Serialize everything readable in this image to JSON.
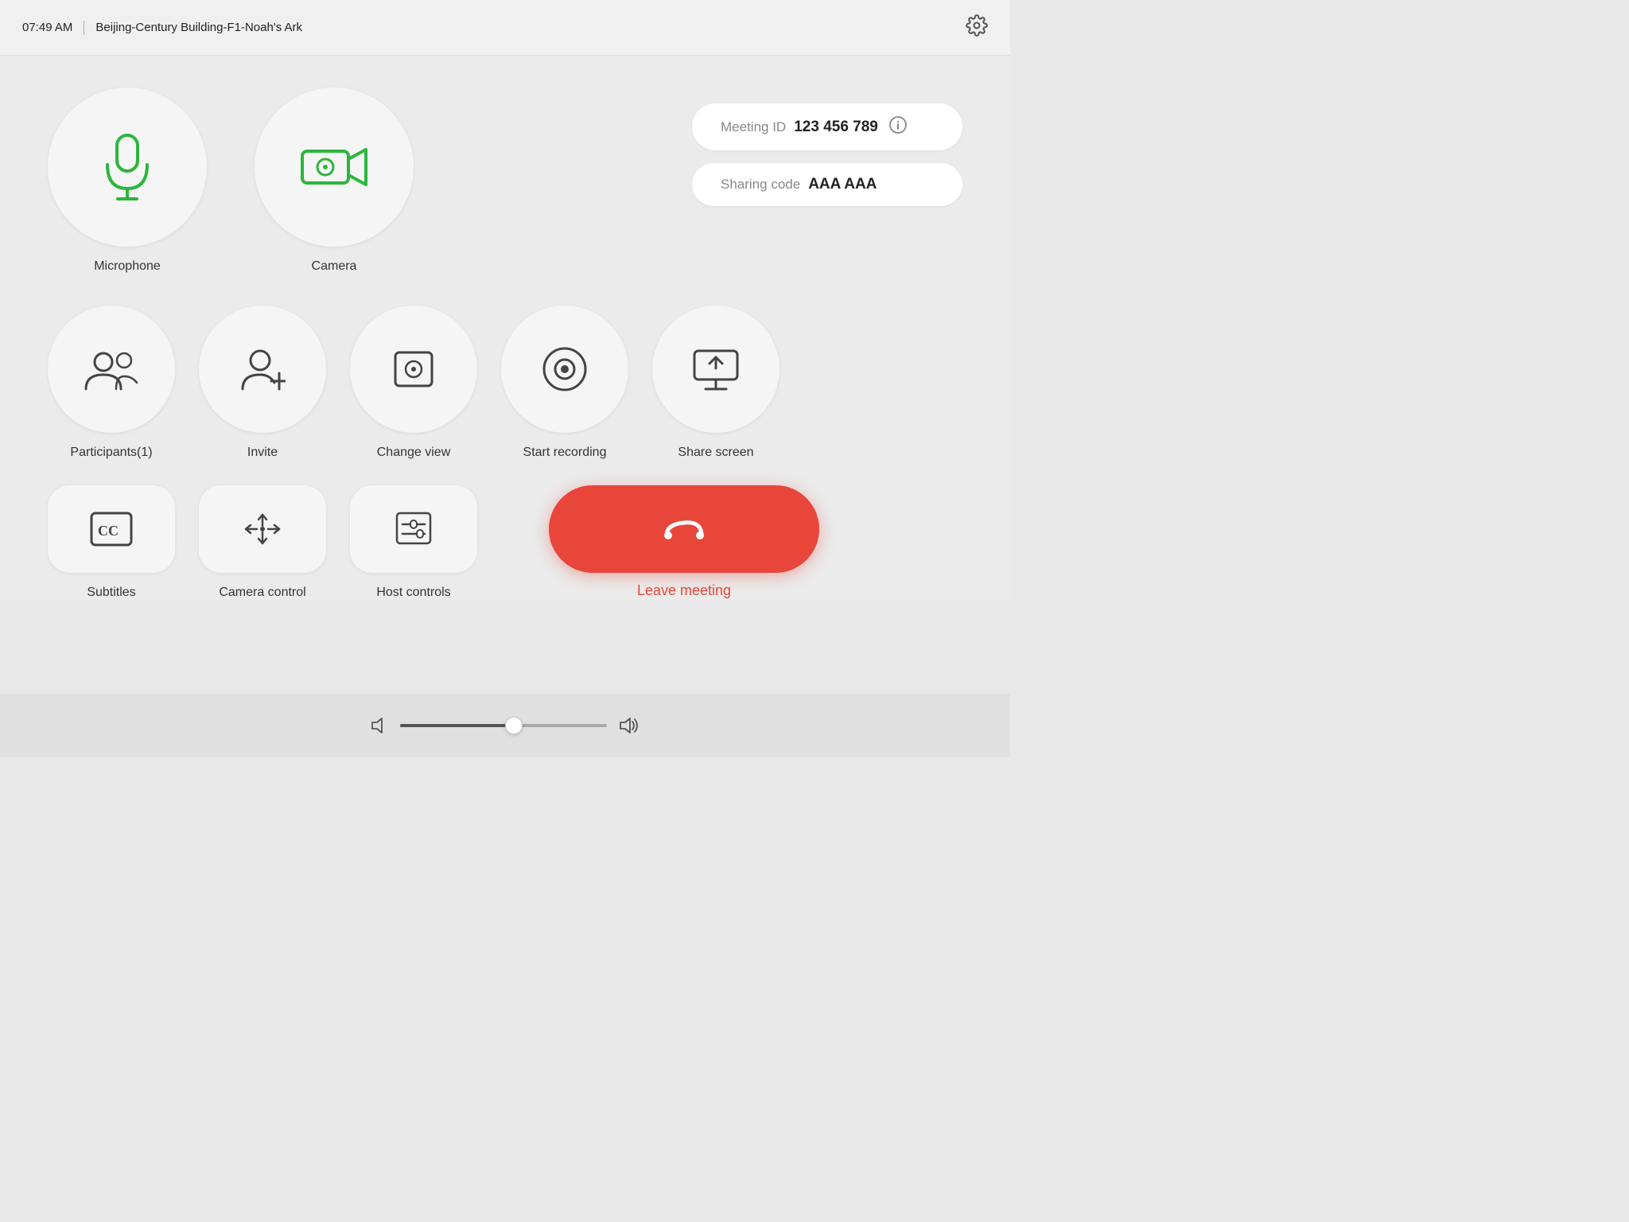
{
  "header": {
    "time": "07:49 AM",
    "room": "Beijing-Century Building-F1-Noah's Ark"
  },
  "meeting": {
    "id_label": "Meeting ID",
    "id_value": "123 456 789",
    "sharing_label": "Sharing code",
    "sharing_value": "AAA AAA"
  },
  "controls": {
    "microphone_label": "Microphone",
    "camera_label": "Camera",
    "participants_label": "Participants(1)",
    "invite_label": "Invite",
    "change_view_label": "Change view",
    "start_recording_label": "Start recording",
    "share_screen_label": "Share screen",
    "subtitles_label": "Subtitles",
    "camera_control_label": "Camera control",
    "host_controls_label": "Host controls",
    "leave_label": "Leave meeting"
  },
  "colors": {
    "green": "#2db53d",
    "red": "#e8463a"
  }
}
